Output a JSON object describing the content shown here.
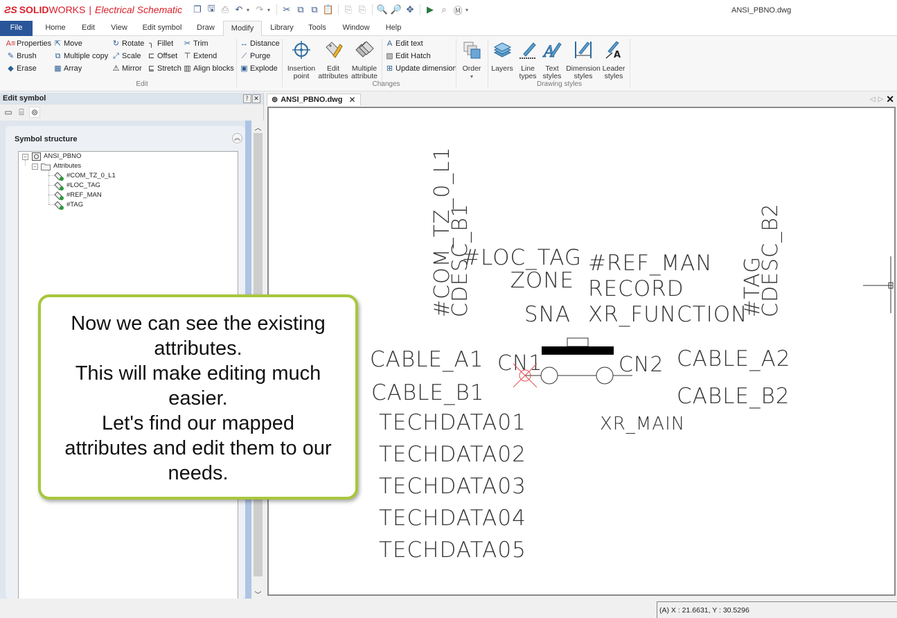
{
  "app": {
    "brand_prefix": "SOLID",
    "brand_suffix": "WORKS",
    "product": "Electrical Schematic",
    "document_title": "ANSI_PBNO.dwg"
  },
  "quick_access": [
    {
      "name": "open-icon",
      "glyph": "❐"
    },
    {
      "name": "save-icon",
      "glyph": "🖫"
    },
    {
      "name": "print-icon",
      "glyph": "⎙"
    },
    {
      "name": "undo-icon",
      "glyph": "↶"
    },
    {
      "name": "redo-icon",
      "glyph": "↷"
    },
    {
      "name": "cut-icon",
      "glyph": "✂"
    },
    {
      "name": "copy-icon",
      "glyph": "⧉"
    },
    {
      "name": "copy-with-base-icon",
      "glyph": "⧉"
    },
    {
      "name": "paste-icon",
      "glyph": "📋"
    },
    {
      "name": "paste-special-icon",
      "glyph": "⎘"
    },
    {
      "name": "paste-block-icon",
      "glyph": "⎘"
    },
    {
      "name": "zoom-realtime-icon",
      "glyph": "🔍"
    },
    {
      "name": "zoom-window-icon",
      "glyph": "🔎"
    },
    {
      "name": "pan-icon",
      "glyph": "✥"
    },
    {
      "name": "run-icon",
      "glyph": "▶"
    },
    {
      "name": "search-icon",
      "glyph": "⌕"
    },
    {
      "name": "macro-icon",
      "glyph": "Ⓜ"
    }
  ],
  "menu_tabs": [
    "File",
    "Home",
    "Edit",
    "View",
    "Edit symbol",
    "Draw",
    "Modify",
    "Library",
    "Tools",
    "Window",
    "Help"
  ],
  "active_tab": "Modify",
  "ribbon": {
    "edit_group": {
      "label": "Edit",
      "items": [
        "Properties",
        "Brush",
        "Erase",
        "Move",
        "Multiple copy",
        "Array",
        "Rotate",
        "Scale",
        "Mirror",
        "Fillet",
        "Offset",
        "Stretch",
        "Trim",
        "Extend",
        "Align blocks"
      ]
    },
    "changes_group": {
      "label": "Changes",
      "small_items": [
        "Distance",
        "Purge",
        "Explode",
        "Edit text",
        "Edit Hatch",
        "Update dimension"
      ],
      "large_items": [
        {
          "line1": "Insertion",
          "line2": "point"
        },
        {
          "line1": "Edit",
          "line2": "attributes"
        },
        {
          "line1": "Multiple",
          "line2": "attribute"
        }
      ]
    },
    "order": {
      "label": "Order",
      "dropdown": "▾"
    },
    "drawing_styles_group": {
      "label": "Drawing styles",
      "items": [
        {
          "line1": "Layers",
          "line2": ""
        },
        {
          "line1": "Line",
          "line2": "types"
        },
        {
          "line1": "Text",
          "line2": "styles"
        },
        {
          "line1": "Dimension",
          "line2": "styles"
        },
        {
          "line1": "Leader",
          "line2": "styles"
        }
      ]
    }
  },
  "left_panel": {
    "title": "Edit symbol",
    "pin": "ᚹ",
    "close": "✕",
    "section_title": "Symbol structure",
    "collapse": "︽",
    "tree": {
      "root": "ANSI_PBNO",
      "folder": "Attributes",
      "attributes": [
        "#COM_TZ_0_L1",
        "#LOC_TAG",
        "#REF_MAN",
        "#TAG"
      ]
    }
  },
  "document_tab": {
    "label": "ANSI_PBNO.dwg",
    "close": "✕"
  },
  "canvas": {
    "vertical_texts": [
      "#COM_TZ_0_L1",
      "CDESC_B1",
      "#TAG",
      "CDESC_B2"
    ],
    "texts": {
      "loc_tag": "#LOC_TAG",
      "zone": "ZONE",
      "sna": "SNA",
      "ref_man": "#REF_MAN",
      "record": "RECORD",
      "xr_function": "XR_FUNCTION",
      "cable_a1": "CABLE_A1",
      "cable_b1": "CABLE_B1",
      "cn1": "CN1",
      "cn2": "CN2",
      "cable_a2": "CABLE_A2",
      "cable_b2": "CABLE_B2",
      "xr_main": "XR_MAIN",
      "techdata": [
        "TECHDATA01",
        "TECHDATA02",
        "TECHDATA03",
        "TECHDATA04",
        "TECHDATA05"
      ]
    }
  },
  "status": {
    "coordinates": "(A) X : 21.6631, Y : 30.5296"
  },
  "callout": {
    "lines": [
      "Now we can see the existing",
      "attributes.",
      "This will make editing much",
      "easier.",
      "Let's find our mapped",
      "attributes and edit them to our",
      "needs."
    ],
    "border_color": "#a8c63c"
  }
}
